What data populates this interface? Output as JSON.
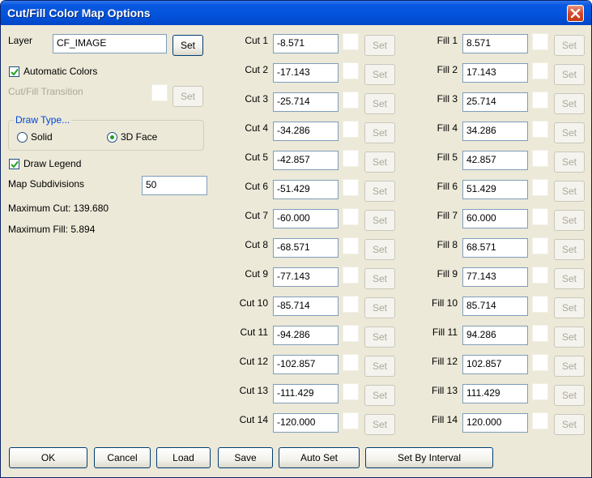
{
  "window": {
    "title": "Cut/Fill Color Map Options"
  },
  "left": {
    "layer_label": "Layer",
    "layer_value": "CF_IMAGE",
    "layer_set": "Set",
    "auto_colors_label": "Automatic Colors",
    "auto_colors_checked": true,
    "transition_label": "Cut/Fill Transition",
    "transition_set": "Set",
    "draw_type_title": "Draw Type...",
    "solid_label": "Solid",
    "face3d_label": "3D Face",
    "selected_draw_type": "3D Face",
    "draw_legend_label": "Draw Legend",
    "draw_legend_checked": true,
    "subdivisions_label": "Map Subdivisions",
    "subdivisions_value": "50",
    "max_cut": "Maximum Cut: 139.680",
    "max_fill": "Maximum Fill: 5.894"
  },
  "cut": [
    {
      "label": "Cut 1",
      "value": "-8.571",
      "set": "Set"
    },
    {
      "label": "Cut 2",
      "value": "-17.143",
      "set": "Set"
    },
    {
      "label": "Cut 3",
      "value": "-25.714",
      "set": "Set"
    },
    {
      "label": "Cut 4",
      "value": "-34.286",
      "set": "Set"
    },
    {
      "label": "Cut 5",
      "value": "-42.857",
      "set": "Set"
    },
    {
      "label": "Cut 6",
      "value": "-51.429",
      "set": "Set"
    },
    {
      "label": "Cut 7",
      "value": "-60.000",
      "set": "Set"
    },
    {
      "label": "Cut 8",
      "value": "-68.571",
      "set": "Set"
    },
    {
      "label": "Cut 9",
      "value": "-77.143",
      "set": "Set"
    },
    {
      "label": "Cut 10",
      "value": "-85.714",
      "set": "Set"
    },
    {
      "label": "Cut 11",
      "value": "-94.286",
      "set": "Set"
    },
    {
      "label": "Cut 12",
      "value": "-102.857",
      "set": "Set"
    },
    {
      "label": "Cut 13",
      "value": "-111.429",
      "set": "Set"
    },
    {
      "label": "Cut 14",
      "value": "-120.000",
      "set": "Set"
    }
  ],
  "fill": [
    {
      "label": "Fill 1",
      "value": "8.571",
      "set": "Set"
    },
    {
      "label": "Fill 2",
      "value": "17.143",
      "set": "Set"
    },
    {
      "label": "Fill 3",
      "value": "25.714",
      "set": "Set"
    },
    {
      "label": "Fill 4",
      "value": "34.286",
      "set": "Set"
    },
    {
      "label": "Fill 5",
      "value": "42.857",
      "set": "Set"
    },
    {
      "label": "Fill 6",
      "value": "51.429",
      "set": "Set"
    },
    {
      "label": "Fill 7",
      "value": "60.000",
      "set": "Set"
    },
    {
      "label": "Fill 8",
      "value": "68.571",
      "set": "Set"
    },
    {
      "label": "Fill 9",
      "value": "77.143",
      "set": "Set"
    },
    {
      "label": "Fill 10",
      "value": "85.714",
      "set": "Set"
    },
    {
      "label": "Fill 11",
      "value": "94.286",
      "set": "Set"
    },
    {
      "label": "Fill 12",
      "value": "102.857",
      "set": "Set"
    },
    {
      "label": "Fill 13",
      "value": "111.429",
      "set": "Set"
    },
    {
      "label": "Fill 14",
      "value": "120.000",
      "set": "Set"
    }
  ],
  "buttons": {
    "ok": "OK",
    "cancel": "Cancel",
    "load": "Load",
    "save": "Save",
    "auto_set": "Auto Set",
    "set_by_interval": "Set By Interval"
  },
  "colors": {
    "titlebar": "#0353dc",
    "dialog_bg": "#ece9d8",
    "group_title": "#0046d5",
    "check_mark": "#21a121",
    "close_button": "#d5482a"
  }
}
